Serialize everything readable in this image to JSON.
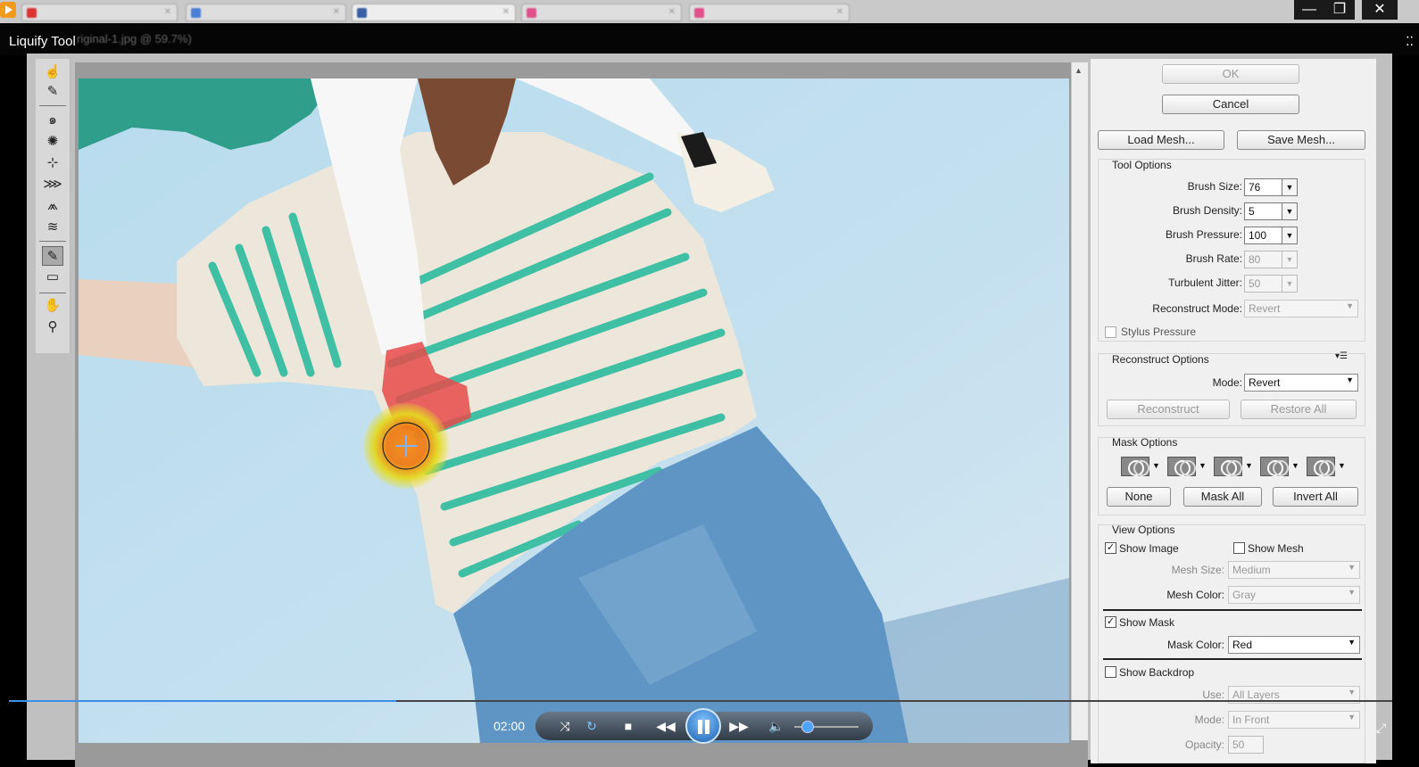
{
  "window": {
    "caption": "Liquify Tool",
    "doc_title": "riginal-1.jpg @ 59.7%)",
    "minimize": "—",
    "maximize": "❐",
    "close": "✕"
  },
  "tabs": [
    "",
    "",
    "",
    "",
    ""
  ],
  "toolbar": {
    "tools": [
      "forward-warp",
      "reconstruct",
      "twirl",
      "pucker",
      "bloat",
      "push-left",
      "mirror",
      "turbulence",
      "freeze-mask",
      "thaw-mask",
      "hand",
      "zoom"
    ],
    "active": "freeze-mask"
  },
  "panel": {
    "ok_label": "OK",
    "cancel_label": "Cancel",
    "load_mesh_label": "Load Mesh...",
    "save_mesh_label": "Save Mesh...",
    "tool_options": {
      "title": "Tool Options",
      "brush_size_label": "Brush Size:",
      "brush_size": "76",
      "brush_density_label": "Brush Density:",
      "brush_density": "5",
      "brush_pressure_label": "Brush Pressure:",
      "brush_pressure": "100",
      "brush_rate_label": "Brush Rate:",
      "brush_rate": "80",
      "turbulent_jitter_label": "Turbulent Jitter:",
      "turbulent_jitter": "50",
      "reconstruct_mode_label": "Reconstruct Mode:",
      "reconstruct_mode": "Revert",
      "stylus_pressure_label": "Stylus Pressure"
    },
    "reconstruct_options": {
      "title": "Reconstruct Options",
      "mode_label": "Mode:",
      "mode": "Revert",
      "reconstruct_label": "Reconstruct",
      "restore_all_label": "Restore All"
    },
    "mask_options": {
      "title": "Mask Options",
      "none_label": "None",
      "mask_all_label": "Mask All",
      "invert_all_label": "Invert All"
    },
    "view_options": {
      "title": "View Options",
      "show_image_label": "Show Image",
      "show_image_checked": true,
      "show_mesh_label": "Show Mesh",
      "show_mesh_checked": false,
      "mesh_size_label": "Mesh Size:",
      "mesh_size": "Medium",
      "mesh_color_label": "Mesh Color:",
      "mesh_color": "Gray",
      "show_mask_label": "Show Mask",
      "show_mask_checked": true,
      "mask_color_label": "Mask Color:",
      "mask_color": "Red",
      "show_backdrop_label": "Show Backdrop",
      "show_backdrop_checked": false,
      "use_label": "Use:",
      "use": "All Layers",
      "mode_label": "Mode:",
      "mode": "In Front",
      "opacity_label": "Opacity:",
      "opacity": "50"
    }
  },
  "player": {
    "time": "02:00",
    "progress": 0.28,
    "volume": 0.2
  },
  "colors": {
    "accent": "#3d8fe6",
    "mask": "#e84a4a"
  }
}
